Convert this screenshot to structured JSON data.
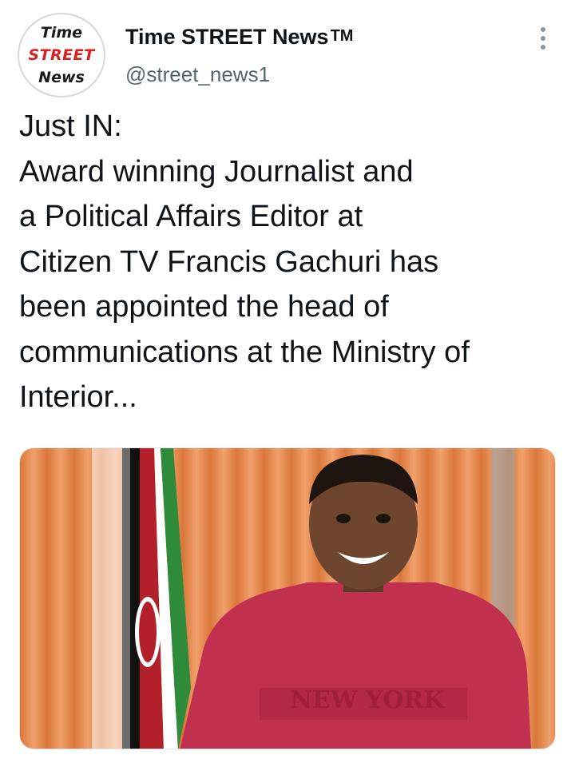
{
  "account": {
    "display_name": "Time STREET News",
    "trademark": "TM",
    "handle": "@street_news1",
    "avatar_logo": {
      "line1": "Time",
      "line2": "STREET",
      "line3": "News"
    }
  },
  "more_menu_icon": "more-vertical-icon",
  "tweet": {
    "lines": [
      "Just IN:",
      "Award winning Journalist and",
      "a Political Affairs Editor at",
      "Citizen TV Francis Gachuri has",
      "been appointed the head of",
      "communications at the Ministry of",
      "Interior..."
    ]
  },
  "media": {
    "shirt_print": "NEW YORK"
  },
  "colors": {
    "logo_red": "#d61f1f",
    "handle_gray": "#536471",
    "curtain_orange": "#e88a4c",
    "shirt_red": "#c2304f"
  }
}
